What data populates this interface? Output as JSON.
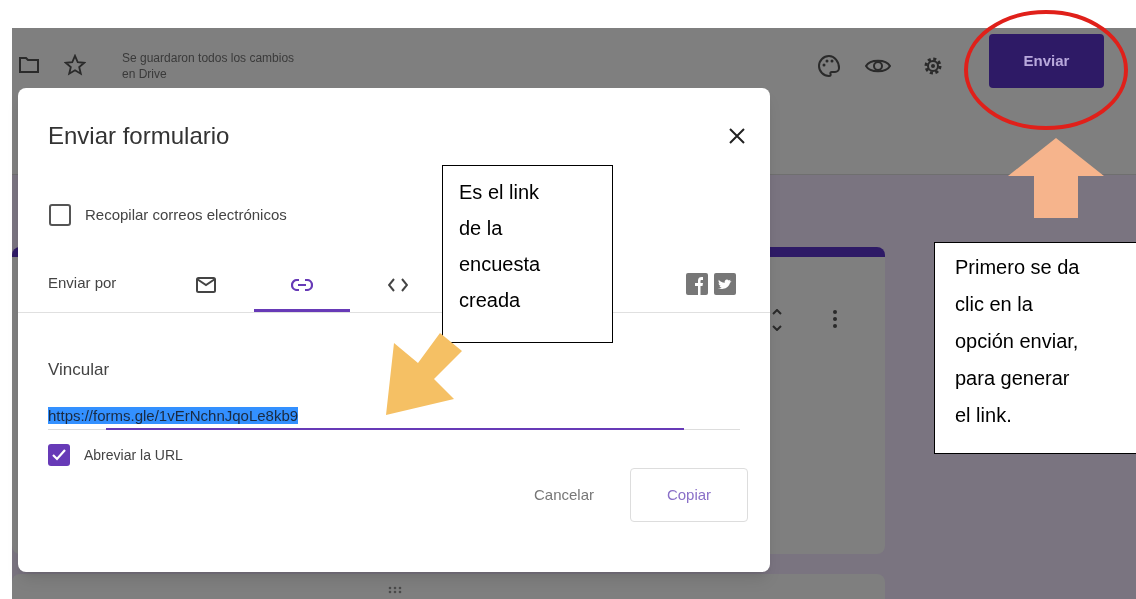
{
  "toolbar": {
    "save_status": "Se guardaron todos los cambios en Drive",
    "send_button": "Enviar"
  },
  "dialog": {
    "title": "Enviar formulario",
    "collect_emails": {
      "label": "Recopilar correos electrónicos",
      "checked": false
    },
    "send_via_label": "Enviar por",
    "tabs": [
      {
        "kind": "email",
        "selected": false
      },
      {
        "kind": "link",
        "selected": true
      },
      {
        "kind": "embed",
        "selected": false
      }
    ],
    "link_label": "Vincular",
    "link_url": "https://forms.gle/1vErNchnJqoLe8kb9",
    "shorten_url": {
      "label": "Abreviar la URL",
      "checked": true
    },
    "buttons": [
      {
        "label": "Cancelar",
        "kind": "text"
      },
      {
        "label": "Copiar",
        "kind": "outlined"
      }
    ]
  },
  "annotations": [
    {
      "kind": "callout",
      "text": "Es el link de la encuesta creada"
    },
    {
      "kind": "callout",
      "text": "Primero se da clic en la opción enviar, para generar el link."
    }
  ]
}
